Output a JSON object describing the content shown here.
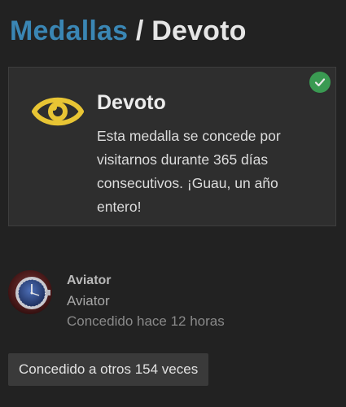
{
  "breadcrumb": {
    "parent": "Medallas",
    "separator": "/",
    "current": "Devoto"
  },
  "badge": {
    "name": "Devoto",
    "description": "Esta medalla se concede por visitarnos durante 365 días consecutivos. ¡Guau, un año entero!",
    "icon": "eye-icon",
    "icon_color": "#e8c534",
    "status_icon": "check-icon",
    "status_color": "#3a9a52"
  },
  "grant": {
    "username": "Aviator",
    "user_title": "Aviator",
    "granted_time": "Concedido hace 12 horas"
  },
  "others_button_label": "Concedido a otros 154 veces",
  "colors": {
    "background": "#222222",
    "card": "#2e2e2e",
    "link": "#3a86b4"
  }
}
